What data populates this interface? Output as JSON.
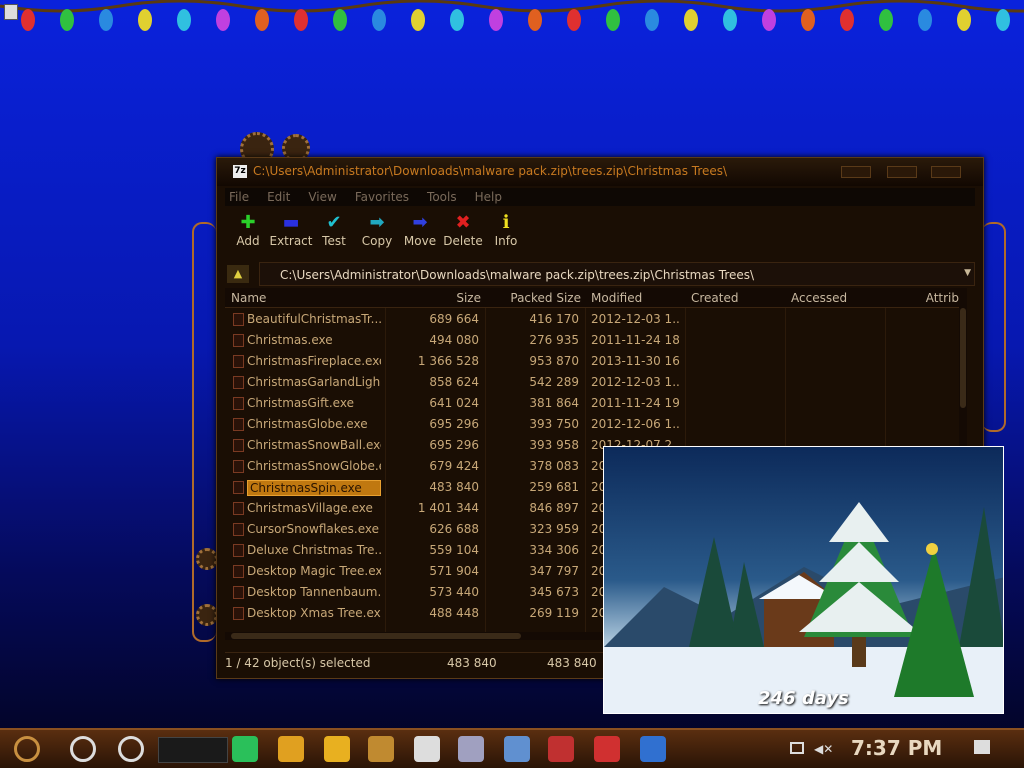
{
  "window": {
    "app_icon": "7z",
    "title": "C:\\Users\\Administrator\\Downloads\\malware pack.zip\\trees.zip\\Christmas Trees\\",
    "menu": [
      "File",
      "Edit",
      "View",
      "Favorites",
      "Tools",
      "Help"
    ],
    "toolbar": [
      {
        "label": "Add",
        "icon": "plus-icon",
        "glyph": "✚",
        "color": "#2ad02a"
      },
      {
        "label": "Extract",
        "icon": "minus-icon",
        "glyph": "▬",
        "color": "#2a30e0"
      },
      {
        "label": "Test",
        "icon": "check-icon",
        "glyph": "✔",
        "color": "#20c0d0"
      },
      {
        "label": "Copy",
        "icon": "copy-arrow-icon",
        "glyph": "➡",
        "color": "#20a8c0"
      },
      {
        "label": "Move",
        "icon": "move-arrow-icon",
        "glyph": "➡",
        "color": "#3040e0"
      },
      {
        "label": "Delete",
        "icon": "delete-x-icon",
        "glyph": "✖",
        "color": "#e02020"
      },
      {
        "label": "Info",
        "icon": "info-icon",
        "glyph": "ℹ",
        "color": "#f0e020"
      }
    ],
    "address": "C:\\Users\\Administrator\\Downloads\\malware pack.zip\\trees.zip\\Christmas Trees\\",
    "columns": [
      "Name",
      "Size",
      "Packed Size",
      "Modified",
      "Created",
      "Accessed",
      "Attrib"
    ],
    "files": [
      {
        "name": "BeautifulChristmasTr...",
        "size": "689 664",
        "packed": "416 170",
        "modified": "2012-12-03 1..."
      },
      {
        "name": "Christmas.exe",
        "size": "494 080",
        "packed": "276 935",
        "modified": "2011-11-24 18..."
      },
      {
        "name": "ChristmasFireplace.exe",
        "size": "1 366 528",
        "packed": "953 870",
        "modified": "2013-11-30 16..."
      },
      {
        "name": "ChristmasGarlandLigh...",
        "size": "858 624",
        "packed": "542 289",
        "modified": "2012-12-03 1..."
      },
      {
        "name": "ChristmasGift.exe",
        "size": "641 024",
        "packed": "381 864",
        "modified": "2011-11-24 19..."
      },
      {
        "name": "ChristmasGlobe.exe",
        "size": "695 296",
        "packed": "393 750",
        "modified": "2012-12-06 1..."
      },
      {
        "name": "ChristmasSnowBall.exe",
        "size": "695 296",
        "packed": "393 958",
        "modified": "2012-12-07 2..."
      },
      {
        "name": "ChristmasSnowGlobe.e...",
        "size": "679 424",
        "packed": "378 083",
        "modified": "20"
      },
      {
        "name": "ChristmasSpin.exe",
        "size": "483 840",
        "packed": "259 681",
        "modified": "20",
        "selected": true
      },
      {
        "name": "ChristmasVillage.exe",
        "size": "1 401 344",
        "packed": "846 897",
        "modified": "20"
      },
      {
        "name": "CursorSnowflakes.exe",
        "size": "626 688",
        "packed": "323 959",
        "modified": "20"
      },
      {
        "name": "Deluxe Christmas Tre...",
        "size": "559 104",
        "packed": "334 306",
        "modified": "20"
      },
      {
        "name": "Desktop Magic Tree.exe",
        "size": "571 904",
        "packed": "347 797",
        "modified": "20"
      },
      {
        "name": "Desktop Tannenbaum.e...",
        "size": "573 440",
        "packed": "345 673",
        "modified": "20"
      },
      {
        "name": "Desktop Xmas Tree.exe",
        "size": "488 448",
        "packed": "269 119",
        "modified": "20"
      }
    ],
    "status": {
      "selected": "1 / 42 object(s) selected",
      "size": "483 840",
      "packed": "483 840"
    }
  },
  "popup": {
    "countdown": "246 days"
  },
  "taskbar": {
    "clock": "7:37 PM",
    "apps": [
      {
        "icon": "start-icon",
        "color": "#8a5a2a"
      },
      {
        "icon": "cortana-circle-icon",
        "color": "#333"
      },
      {
        "icon": "task-view-icon",
        "color": "#333"
      },
      {
        "icon": "chat-app-icon",
        "color": "#2ac05a"
      },
      {
        "icon": "chrome-icon",
        "color": "#e0a020"
      },
      {
        "icon": "file-explorer-icon",
        "color": "#e8b020"
      },
      {
        "icon": "photo-app-icon",
        "color": "#c08a30"
      },
      {
        "icon": "7zip-icon",
        "color": "#dddddd"
      },
      {
        "icon": "tools-icon",
        "color": "#a0a0c0"
      },
      {
        "icon": "installer-icon",
        "color": "#6090d0"
      },
      {
        "icon": "repair-tools-icon",
        "color": "#c03030"
      },
      {
        "icon": "chat-bubble-icon",
        "color": "#d03030"
      },
      {
        "icon": "shield-icon",
        "color": "#3070d0"
      }
    ]
  }
}
